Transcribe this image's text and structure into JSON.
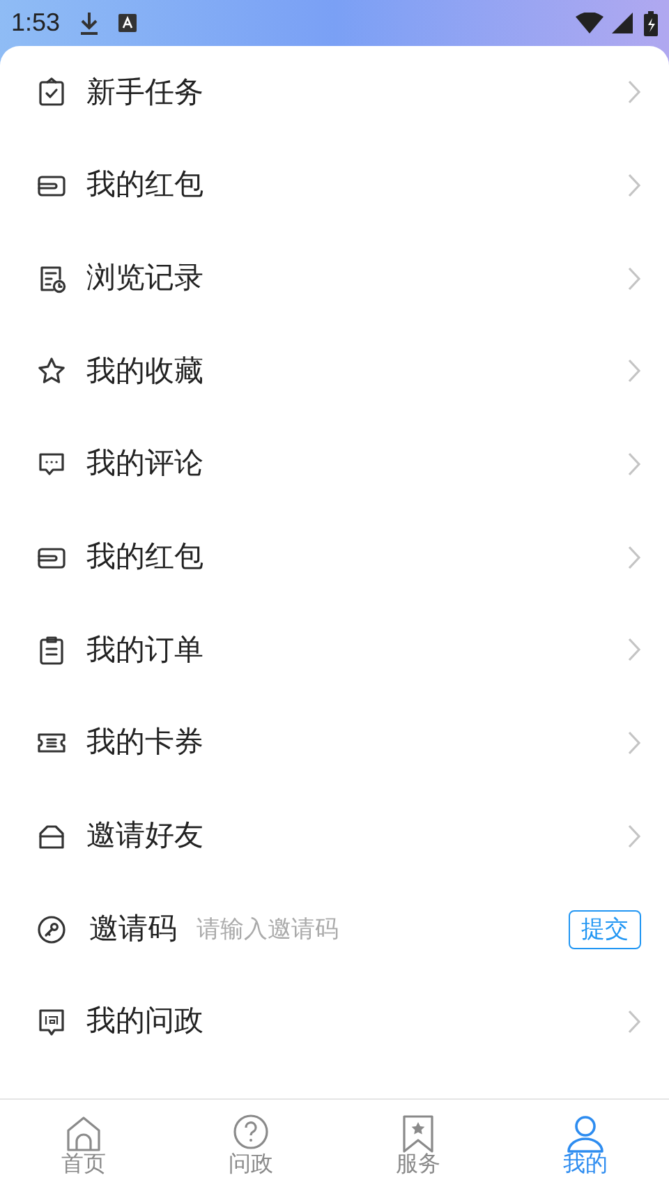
{
  "status_bar": {
    "time": "1:53"
  },
  "menu": [
    {
      "kind": "link",
      "label": "新手任务"
    },
    {
      "kind": "link",
      "label": "我的红包"
    },
    {
      "kind": "link",
      "label": "浏览记录"
    },
    {
      "kind": "link",
      "label": "我的收藏"
    },
    {
      "kind": "link",
      "label": "我的评论"
    },
    {
      "kind": "link",
      "label": "我的红包"
    },
    {
      "kind": "link",
      "label": "我的订单"
    },
    {
      "kind": "link",
      "label": "我的卡券"
    },
    {
      "kind": "link",
      "label": "邀请好友"
    },
    {
      "kind": "code_input",
      "label": "邀请码",
      "placeholder": "请输入邀请码",
      "button": "提交"
    },
    {
      "kind": "link",
      "label": "我的问政"
    }
  ],
  "bottom_nav": [
    {
      "label": "首页",
      "selected": false
    },
    {
      "label": "问政",
      "selected": false
    },
    {
      "label": "服务",
      "selected": false
    },
    {
      "label": "我的",
      "selected": true
    }
  ]
}
